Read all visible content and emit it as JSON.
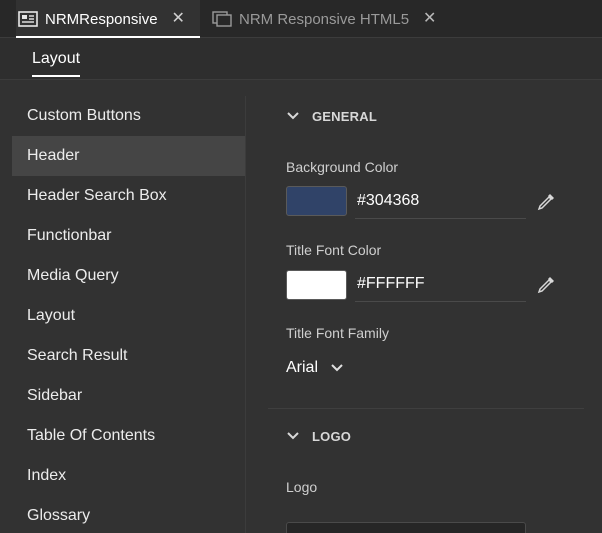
{
  "tabs": [
    {
      "label": "NRMResponsive",
      "icon": "layout-icon",
      "active": true
    },
    {
      "label": "NRM Responsive HTML5",
      "icon": "copy-icon",
      "active": false
    }
  ],
  "close_glyph": "✕",
  "subtabs": [
    {
      "label": "Layout"
    }
  ],
  "sidebar": {
    "items": [
      {
        "label": "Custom Buttons"
      },
      {
        "label": "Header",
        "selected": true
      },
      {
        "label": "Header Search Box"
      },
      {
        "label": "Functionbar"
      },
      {
        "label": "Media Query"
      },
      {
        "label": "Layout"
      },
      {
        "label": "Search Result"
      },
      {
        "label": "Sidebar"
      },
      {
        "label": "Table Of Contents"
      },
      {
        "label": "Index"
      },
      {
        "label": "Glossary"
      }
    ]
  },
  "general": {
    "title": "GENERAL",
    "background_color": {
      "label": "Background Color",
      "value": "#304368",
      "swatch": "#304368"
    },
    "title_font_color": {
      "label": "Title Font Color",
      "value": "#FFFFFF",
      "swatch": "#FFFFFF"
    },
    "title_font_family": {
      "label": "Title Font Family",
      "value": "Arial"
    }
  },
  "logo": {
    "title": "LOGO",
    "field_label": "Logo"
  },
  "colors": {
    "background": "#323232",
    "tabstrip": "#282828",
    "selected_item": "#454545"
  }
}
